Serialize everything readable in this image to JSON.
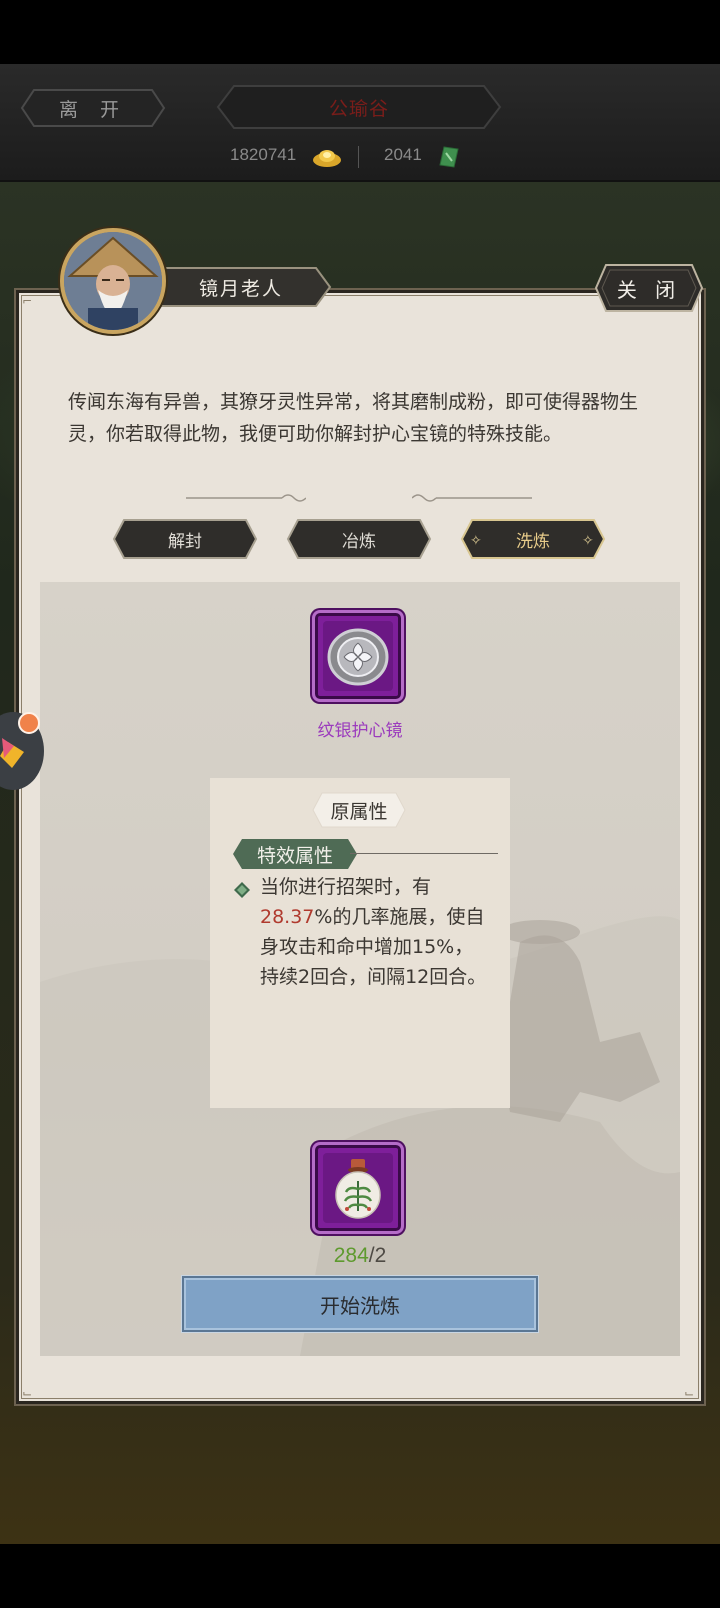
{
  "header": {
    "leave_label": "离 开",
    "location_title": "公瑜谷",
    "gold_amount": "1820741",
    "jade_amount": "2041",
    "gold_icon": "gold-ingot-icon",
    "jade_icon": "jade-icon"
  },
  "npc": {
    "name": "镜月老人",
    "avatar_icon": "old-man-portrait",
    "close_label": "关 闭",
    "dialogue": "传闻东海有异兽，其獠牙灵性异常，将其磨制成粉，即可使得器物生灵，你若取得此物，我便可助你解封护心宝镜的特殊技能。"
  },
  "tabs": [
    {
      "label": "解封",
      "selected": false
    },
    {
      "label": "冶炼",
      "selected": false
    },
    {
      "label": "洗炼",
      "selected": true
    }
  ],
  "equipment": {
    "name": "纹银护心镜",
    "icon": "silver-mirror-icon",
    "rarity_color": "#7e1f9a"
  },
  "attributes": {
    "section_title": "原属性",
    "tag": "特效属性",
    "text_before": "当你进行招架时，有",
    "chance": "28.37",
    "text_after": "%的几率施展，使自身攻击和命中增加15%，持续2回合，间隔12回合。"
  },
  "material": {
    "icon": "medicine-pouch-icon",
    "have": "284",
    "need": "/2"
  },
  "start_label": "开始洗炼",
  "colors": {
    "accent_purple": "#9b3bbd",
    "highlight_red": "#b03a2e",
    "count_green": "#5e9a2e",
    "button_blue": "#7fa2c6",
    "tag_green": "#4f6b55"
  }
}
